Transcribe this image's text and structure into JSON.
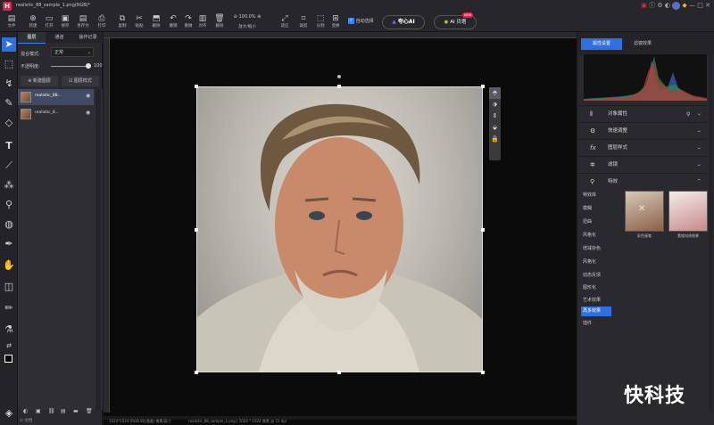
{
  "app": {
    "title": "realistic_88_sample_1.png(RGB)*",
    "logo_letter": "H"
  },
  "toolbar": {
    "file": "文件",
    "items": [
      {
        "icon": "⊕",
        "label": "新建"
      },
      {
        "icon": "▭",
        "label": "打开"
      },
      {
        "icon": "▣",
        "label": "保存"
      },
      {
        "icon": "▤",
        "label": "另存为"
      },
      {
        "icon": "⎙",
        "label": "打印"
      },
      {
        "icon": "⧉",
        "label": "复制"
      },
      {
        "icon": "✂",
        "label": "粘贴"
      },
      {
        "icon": "⬒",
        "label": "删除"
      },
      {
        "icon": "↶",
        "label": "撤销"
      },
      {
        "icon": "↷",
        "label": "重做"
      },
      {
        "icon": "▥",
        "label": "对齐"
      },
      {
        "icon": "🗑",
        "label": "删除"
      }
    ],
    "zoom_value": "100.0%",
    "zoom_label": "放大/缩小",
    "right_items": [
      {
        "icon": "⤢",
        "label": "适应"
      },
      {
        "icon": "⌗",
        "label": "裁剪"
      },
      {
        "icon": "⬚",
        "label": "分割"
      },
      {
        "icon": "⊞",
        "label": "变换"
      },
      {
        "icon": "⊠",
        "label": "选区"
      }
    ],
    "auto_select": "自动选择",
    "ai_brand": "夸心AI",
    "ai_button": "AI 贝塔",
    "ai_badge": "NEW"
  },
  "layers_panel": {
    "tabs": [
      "图层",
      "通道",
      "操作记录"
    ],
    "blend_label": "混合模式:",
    "blend_value": "正常",
    "opacity_label": "不透明度:",
    "opacity_value": "100",
    "opacity_unit": "%",
    "buttons": [
      "新建图层",
      "图层样式"
    ],
    "layers": [
      {
        "name": "realistic_88...",
        "selected": true
      },
      {
        "name": "realistic_8...",
        "selected": false
      }
    ]
  },
  "right_panel": {
    "tabs": [
      "属性设置",
      "滤镜效果"
    ],
    "sections": [
      "对象属性",
      "快速调整",
      "图层样式",
      "滤镜",
      "特效"
    ],
    "effect_categories": [
      "特效库",
      "模糊",
      "扭曲",
      "风格化",
      "增减杂色",
      "风格化",
      "动态反馈",
      "图形化",
      "艺术效果",
      "再多效果",
      "插件"
    ],
    "selected_category": "再多效果",
    "thumbnails": [
      {
        "label": "彩色画笔"
      },
      {
        "label": "素描勾线效果"
      }
    ]
  },
  "statusbar": {
    "left": "⊙ 文档",
    "doc_info": "realistic_88_sample_1.png | 1024 * 1024 像素 @ 72 dpi",
    "coords": "1024*1024 (RGB 8位通道) 像素/英寸"
  },
  "watermark": "快科技"
}
